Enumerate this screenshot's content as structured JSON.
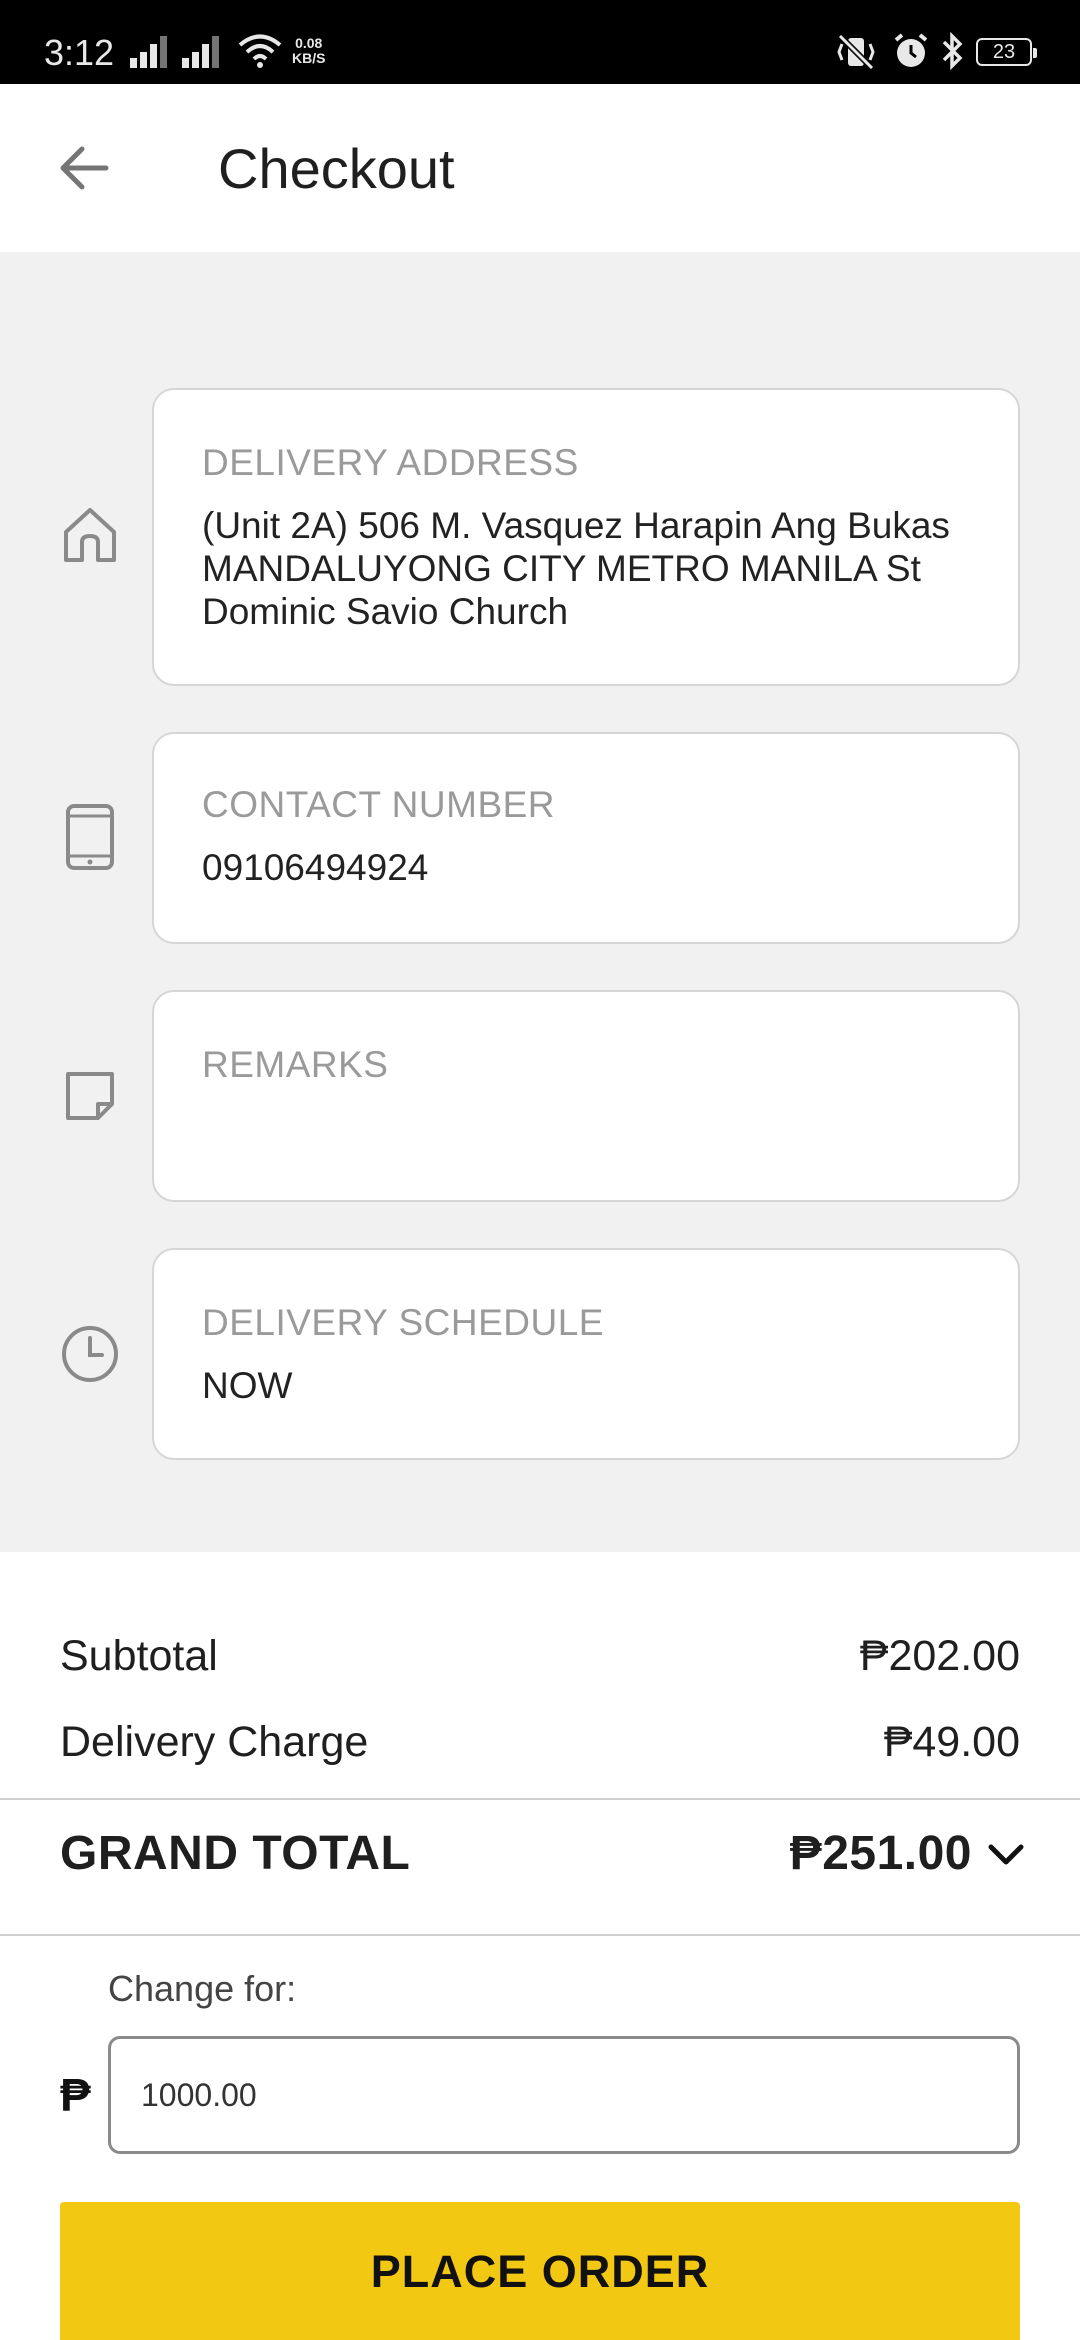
{
  "status_bar": {
    "time": "3:12",
    "speed_value": "0.08",
    "speed_unit": "KB/S",
    "battery": "23"
  },
  "header": {
    "title": "Checkout"
  },
  "fields": {
    "address": {
      "label": "DELIVERY ADDRESS",
      "value": "(Unit 2A) 506 M. Vasquez Harapin Ang Bukas MANDALUYONG CITY METRO MANILA St Dominic Savio Church",
      "icon": "home-icon"
    },
    "contact": {
      "label": "CONTACT NUMBER",
      "value": "09106494924",
      "icon": "phone-icon"
    },
    "remarks": {
      "label": "REMARKS",
      "value": "",
      "icon": "note-icon"
    },
    "schedule": {
      "label": "DELIVERY SCHEDULE",
      "value": "NOW",
      "icon": "clock-icon"
    }
  },
  "totals": {
    "subtotal_label": "Subtotal",
    "subtotal_value": "₱202.00",
    "delivery_label": "Delivery Charge",
    "delivery_value": "₱49.00",
    "grand_label": "GRAND TOTAL",
    "grand_value": "₱251.00"
  },
  "payment": {
    "change_label": "Change for:",
    "currency_symbol": "₱",
    "change_value": "1000.00"
  },
  "actions": {
    "place_order_label": "PLACE ORDER"
  },
  "colors": {
    "accent": "#f2c813",
    "form_background": "#f1f1f1"
  }
}
